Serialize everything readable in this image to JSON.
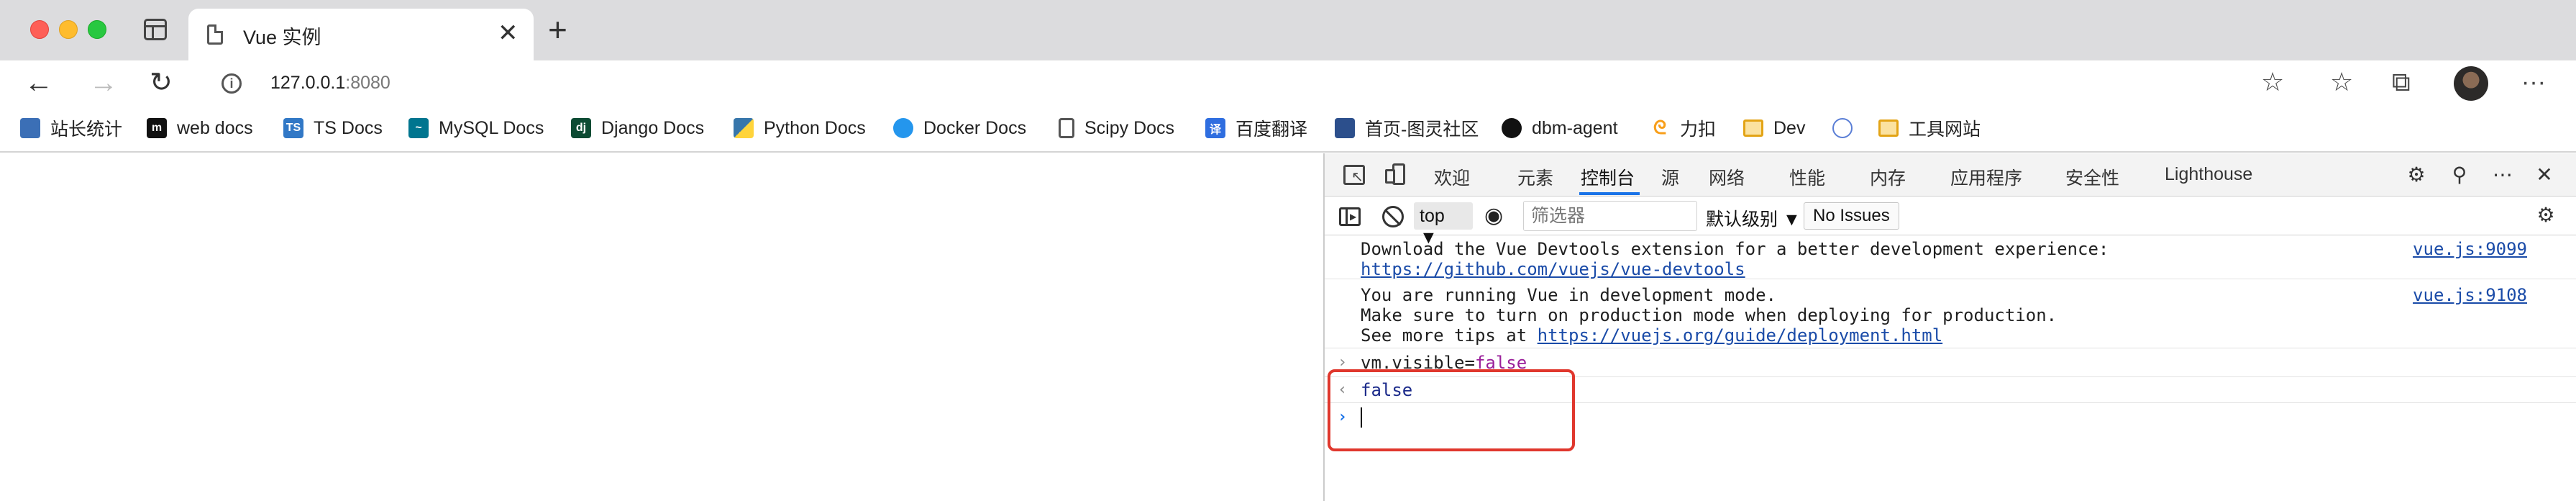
{
  "tab": {
    "title": "Vue 实例",
    "close": "✕",
    "new_tab": "+"
  },
  "address": {
    "host": "127.0.0.1",
    "port": ":8080"
  },
  "bookmarks": [
    {
      "label": "站长统计",
      "icon": "bird-icon",
      "color": "#3b6fb6"
    },
    {
      "label": "web docs",
      "icon": "mdn-icon",
      "color": "#111111"
    },
    {
      "label": "TS Docs",
      "icon": "ts-icon",
      "color": "#3178c6"
    },
    {
      "label": "MySQL Docs",
      "icon": "mysql-icon",
      "color": "#00758f"
    },
    {
      "label": "Django Docs",
      "icon": "django-icon",
      "color": "#0c4b33"
    },
    {
      "label": "Python Docs",
      "icon": "python-icon",
      "color": "#3776ab"
    },
    {
      "label": "Docker Docs",
      "icon": "docker-icon",
      "color": "#2496ed"
    },
    {
      "label": "Scipy Docs",
      "icon": "page-icon",
      "color": "#555555"
    },
    {
      "label": "百度翻译",
      "icon": "translate-icon",
      "color": "#2f6ee0"
    },
    {
      "label": "首页-图灵社区",
      "icon": "turing-icon",
      "color": "#2c4f8c"
    },
    {
      "label": "dbm-agent",
      "icon": "github-icon",
      "color": "#111111"
    },
    {
      "label": "力扣",
      "icon": "leetcode-icon",
      "color": "#f89f1b"
    },
    {
      "label": "Dev",
      "icon": "folder-icon",
      "color": "#e3a416"
    },
    {
      "label": "",
      "icon": "app-icon",
      "color": "#5b7fd6"
    },
    {
      "label": "工具网站",
      "icon": "folder-icon",
      "color": "#e3a416"
    }
  ],
  "devtools": {
    "tabs": [
      "欢迎",
      "元素",
      "控制台",
      "源",
      "网络",
      "性能",
      "内存",
      "应用程序",
      "安全性",
      "Lighthouse"
    ],
    "active_tab": "控制台",
    "context": "top ▼",
    "filter_placeholder": "筛选器",
    "levels": "默认级别 ▼",
    "issues": "No Issues"
  },
  "console": {
    "msg1_line1": "Download the Vue Devtools extension for a better development experience:",
    "msg1_link": "https://github.com/vuejs/vue-devtools",
    "msg1_src": "vue.js:9099",
    "msg2_line1": "You are running Vue in development mode.",
    "msg2_line2": "Make sure to turn on production mode when deploying for production.",
    "msg2_line3_prefix": "See more tips at ",
    "msg2_link": "https://vuejs.org/guide/deployment.html",
    "msg2_src": "vue.js:9108",
    "input_code": "vm.visible=",
    "input_value": "false",
    "result": "false"
  }
}
